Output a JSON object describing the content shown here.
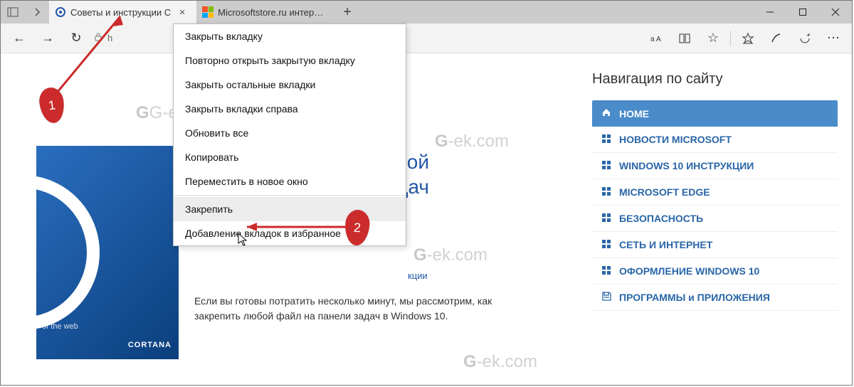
{
  "titlebar": {
    "tabs": [
      {
        "title": "Советы и инструкции С",
        "active": true
      },
      {
        "title": "Microsoftstore.ru интернет",
        "active": false
      }
    ]
  },
  "toolbar": {
    "address_prefix": "h"
  },
  "context_menu": {
    "items": [
      "Закрыть вкладку",
      "Повторно открыть закрытую вкладку",
      "Закрыть остальные вкладки",
      "Закрыть вкладки справа",
      "Обновить все",
      "Копировать",
      "Переместить в новое окно",
      "Закрепить",
      "Добавление вкладок в избранное"
    ],
    "highlighted_index": 7
  },
  "article": {
    "heading_line1": "обой",
    "heading_line2": "задач",
    "breadcrumb_tail": "кции",
    "paragraph": "Если вы готовы потратить несколько минут, мы рассмотрим, как закрепить любой файл на панели задач в Windows 10.",
    "img_small_text": "of the web",
    "img_brand": "CORTANA"
  },
  "sidebar": {
    "title": "Навигация по сайту",
    "items": [
      {
        "label": "HOME",
        "icon": "home-icon",
        "active": true
      },
      {
        "label": "НОВОСТИ MICROSOFT",
        "icon": "tiles-icon"
      },
      {
        "label": "WINDOWS 10 ИНСТРУКЦИИ",
        "icon": "tiles-icon"
      },
      {
        "label": "MICROSOFT EDGE",
        "icon": "tiles-icon"
      },
      {
        "label": "БЕЗОПАСНОСТЬ",
        "icon": "tiles-icon"
      },
      {
        "label": "СЕТЬ И ИНТЕРНЕТ",
        "icon": "tiles-icon"
      },
      {
        "label": "ОФОРМЛЕНИЕ WINDOWS 10",
        "icon": "tiles-icon"
      },
      {
        "label": "ПРОГРАММЫ и ПРИЛОЖЕНИЯ",
        "icon": "save-icon"
      }
    ]
  },
  "annotations": {
    "badge1": "1",
    "badge2": "2"
  },
  "watermark": "G-ek.com"
}
